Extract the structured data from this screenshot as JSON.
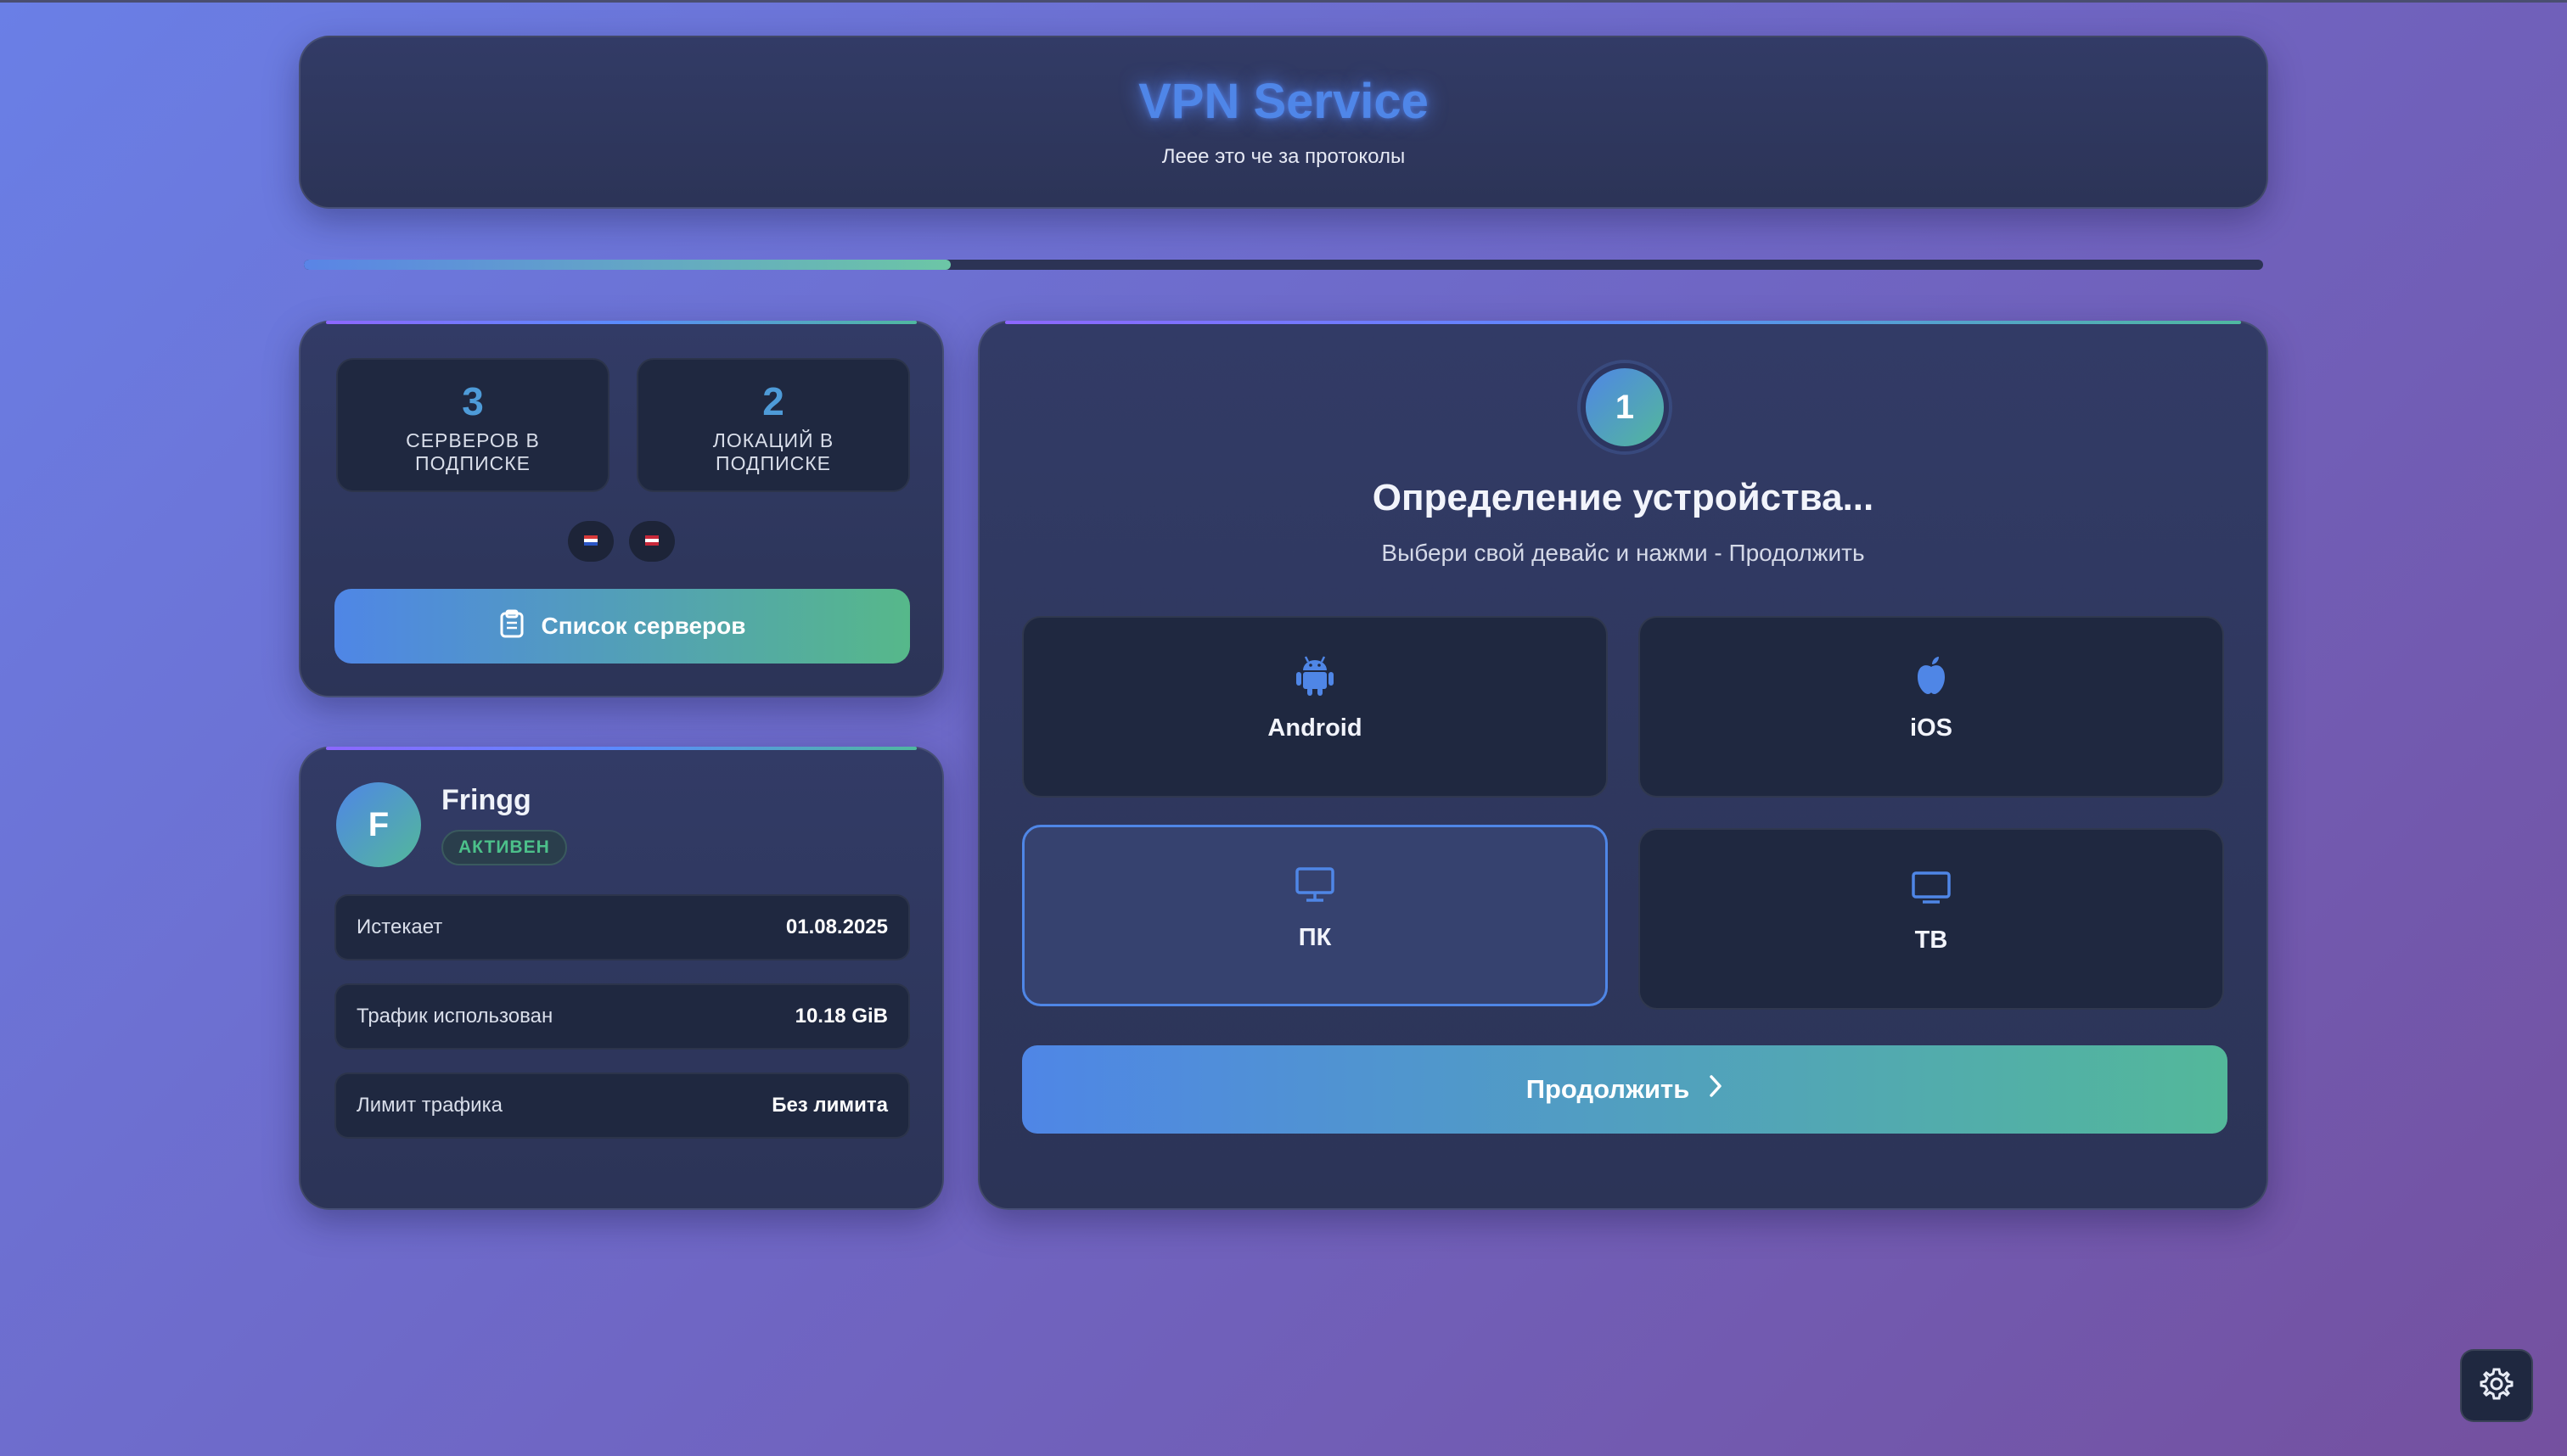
{
  "header": {
    "title": "VPN Service",
    "subtitle": "Леее это че за протоколы"
  },
  "progress": {
    "value_percent": 33
  },
  "stats": {
    "servers_value": "3",
    "servers_label": "Серверов в подписке",
    "locations_value": "2",
    "locations_label": "Локаций в подписке",
    "flags": [
      {
        "icon": "flag-icon",
        "colors": [
          "#d83a3a",
          "#ffffff",
          "#2a56c6"
        ]
      },
      {
        "icon": "flag-icon",
        "colors": [
          "#c8283a",
          "#ffffff",
          "#c8283a"
        ]
      }
    ],
    "servers_button_label": "Список серверов",
    "servers_button_icon": "clipboard-icon"
  },
  "user": {
    "avatar_letter": "F",
    "name": "Fringg",
    "status": "Активен",
    "rows": [
      {
        "key": "Истекает",
        "value": "01.08.2025"
      },
      {
        "key": "Трафик использован",
        "value": "10.18 GiB"
      },
      {
        "key": "Лимит трафика",
        "value": "Без лимита"
      }
    ]
  },
  "wizard": {
    "step": "1",
    "title": "Определение устройства...",
    "subtitle": "Выбери свой девайс и нажми - Продолжить",
    "devices": [
      {
        "label": "Android",
        "icon": "android-icon",
        "selected": false
      },
      {
        "label": "iOS",
        "icon": "apple-icon",
        "selected": false
      },
      {
        "label": "ПК",
        "icon": "monitor-icon",
        "selected": true
      },
      {
        "label": "ТВ",
        "icon": "tv-icon",
        "selected": false
      }
    ],
    "continue_label": "Продолжить",
    "continue_icon": "chevron-right-icon"
  },
  "settings": {
    "icon": "gear-icon"
  },
  "colors": {
    "accent_blue": "#4f86e6",
    "accent_green": "#53b89a",
    "status_green": "#4cc08a"
  }
}
